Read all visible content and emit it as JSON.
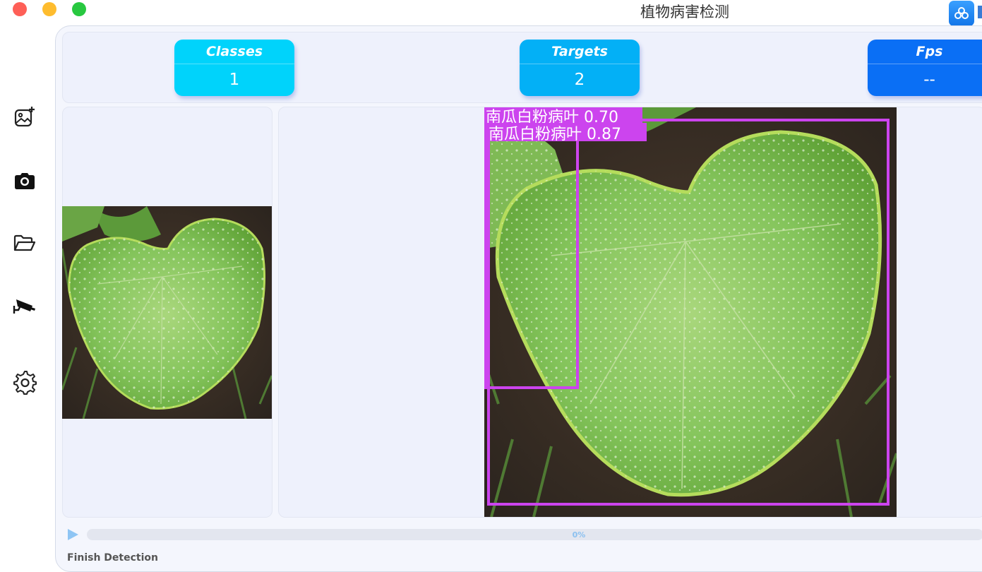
{
  "window": {
    "title": "植物病害检测"
  },
  "sidebar": {
    "items": [
      {
        "icon": "image-add-icon"
      },
      {
        "icon": "camera-icon"
      },
      {
        "icon": "folder-open-icon"
      },
      {
        "icon": "video-camera-icon"
      },
      {
        "icon": "gear-icon"
      }
    ]
  },
  "stats": {
    "classes_label": "Classes",
    "classes_value": "1",
    "targets_label": "Targets",
    "targets_value": "2",
    "fps_label": "Fps",
    "fps_value": "--"
  },
  "detections": [
    {
      "label": "南瓜白粉病叶 0.87",
      "color": "#cc44ee"
    },
    {
      "label": "南瓜白粉病叶 0.70",
      "color": "#cc44ee"
    }
  ],
  "progress": {
    "value": 0,
    "text": "0%"
  },
  "status": {
    "text": "Finish Detection"
  },
  "colors": {
    "accent": "#1e90ff",
    "box": "#cc44ee",
    "classes": "#00d3fb",
    "targets": "#03b0f6",
    "fps": "#0a6ff5"
  }
}
